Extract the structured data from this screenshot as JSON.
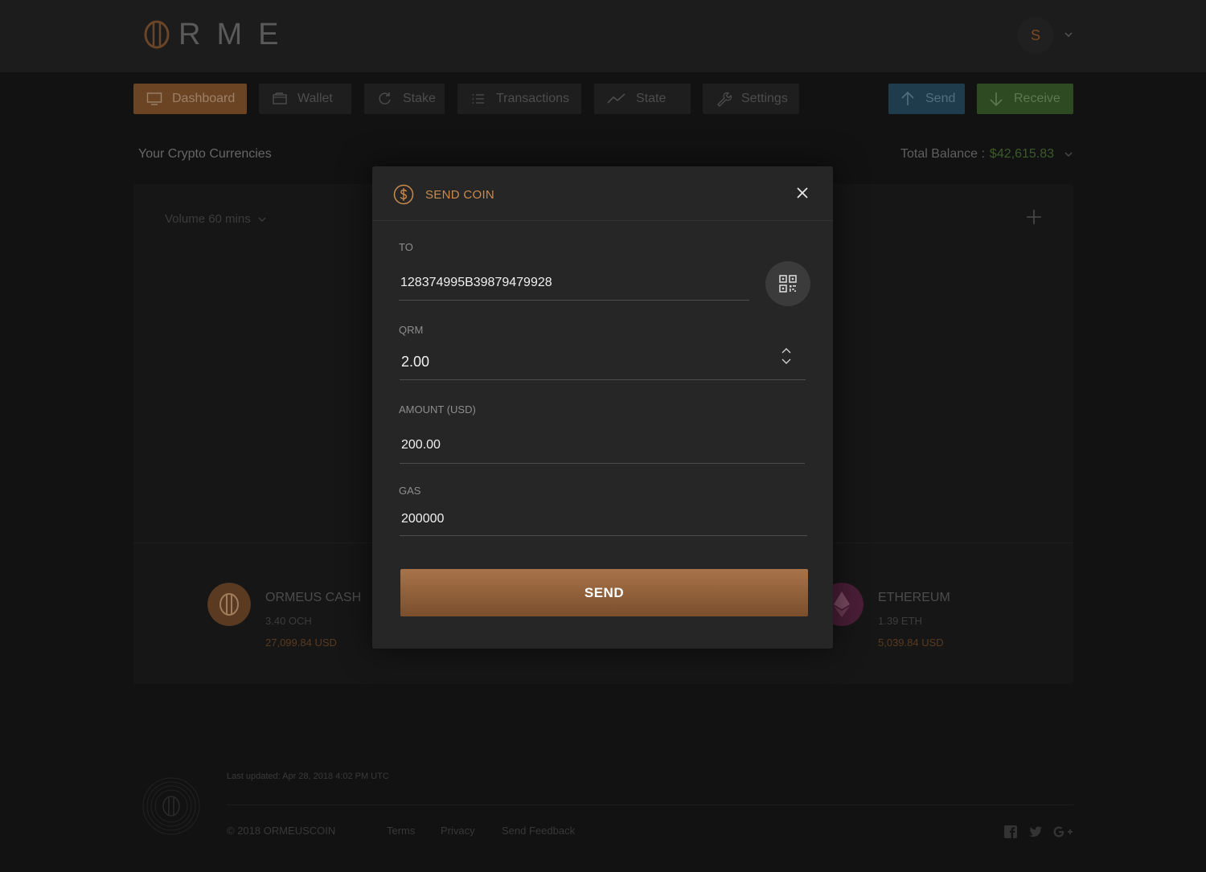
{
  "app": {
    "logo_text": "RME"
  },
  "header": {
    "avatar_initial": "S"
  },
  "nav": {
    "items": [
      {
        "label": "Dashboard",
        "icon": "monitor-icon",
        "active": true
      },
      {
        "label": "Wallet",
        "icon": "wallet-icon",
        "active": false
      },
      {
        "label": "Stake",
        "icon": "refresh-icon",
        "active": false
      },
      {
        "label": "Transactions",
        "icon": "list-icon",
        "active": false
      },
      {
        "label": "State",
        "icon": "trend-icon",
        "active": false
      },
      {
        "label": "Settings",
        "icon": "wrench-icon",
        "active": false
      }
    ],
    "send_label": "Send",
    "receive_label": "Receive"
  },
  "dashboard": {
    "section_title": "Your Crypto Currencies",
    "total_balance_label": "Total Balance :",
    "total_balance_value": "$42,615.83",
    "volume_label": "Volume 60 mins",
    "coins": [
      {
        "name": "ORMEUS CASH",
        "amount": "3.40 OCH",
        "usd": "27,099.84 USD",
        "icon": "ormeus-icon"
      },
      {
        "name": "ETHEREUM",
        "amount": "1.39 ETH",
        "usd": "5,039.84 USD",
        "icon": "ethereum-icon"
      }
    ]
  },
  "footer": {
    "last_updated": "Last updated: Apr 28, 2018 4:02 PM UTC",
    "copyright": "© 2018 ORMEUSCOIN",
    "links": [
      "Terms",
      "Privacy",
      "Send Feedback"
    ],
    "social": [
      "facebook-icon",
      "twitter-icon",
      "google-plus-icon"
    ]
  },
  "modal": {
    "title": "SEND COIN",
    "to_label": "TO",
    "to_value": "128374995B39879479928",
    "qrm_label": "QRM",
    "qrm_value": "2.00",
    "amount_label": "AMOUNT (USD)",
    "amount_value": "200.00",
    "gas_label": "GAS",
    "gas_value": "200000",
    "send_button": "SEND"
  },
  "colors": {
    "accent": "#c98a4d",
    "send_button": "#8f5f38",
    "modal_bg": "#262626",
    "page_bg": "#121212"
  }
}
